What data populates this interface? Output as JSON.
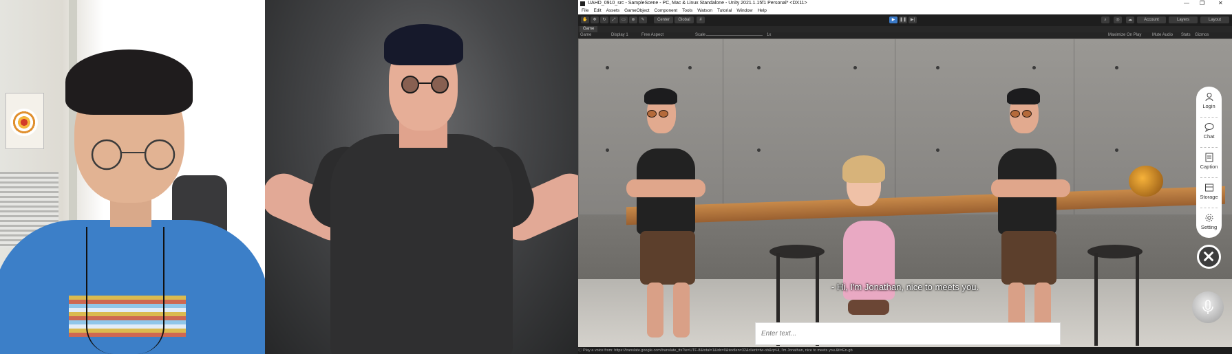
{
  "window": {
    "title": "UAHD_0910_src - SampleScene - PC, Mac & Linux Standalone - Unity 2021.1.15f1 Personal* <DX11>"
  },
  "menu": [
    "File",
    "Edit",
    "Assets",
    "GameObject",
    "Component",
    "Tools",
    "Watson",
    "Tutorial",
    "Window",
    "Help"
  ],
  "toolbar": {
    "center_label": "Center",
    "global_label": "Global",
    "account_label": "Account",
    "layers_label": "Layers",
    "layout_label": "Layout"
  },
  "game_panel": {
    "tab_label": "Game",
    "display_mode": "Game",
    "display": "Display 1",
    "aspect": "Free Aspect",
    "scale_label": "Scale",
    "scale_value": "1x",
    "maximize_on_play": "Maximize On Play",
    "mute_audio": "Mute Audio",
    "stats": "Stats",
    "gizmos": "Gizmos"
  },
  "side_menu": {
    "items": [
      {
        "label": "Login",
        "icon": "user-icon"
      },
      {
        "label": "Chat",
        "icon": "chat-icon"
      },
      {
        "label": "Caption",
        "icon": "caption-icon"
      },
      {
        "label": "Storage",
        "icon": "storage-icon"
      },
      {
        "label": "Setting",
        "icon": "gear-icon"
      }
    ]
  },
  "caption": "- Hi, I'm Jonathan, nice to meets you.",
  "chat_input": {
    "placeholder": "Enter text..."
  },
  "status_bar": "Play a voice from: https://translate.google.com/translate_tts?ie=UTF-8&total=1&idx=0&textlen=32&client=tw-ob&q=Hi, I'm Jonathan, nice to meets you.&tl=En-gb",
  "colors": {
    "play_button": "#3a79c7",
    "editor_background": "#191919",
    "shirt_blue": "#3c7fc8"
  }
}
